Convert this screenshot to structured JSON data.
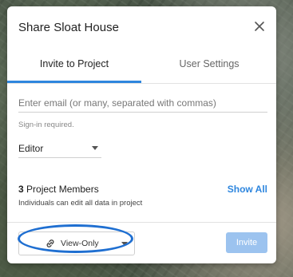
{
  "dialog": {
    "title": "Share Sloat House"
  },
  "tabs": [
    {
      "label": "Invite to Project",
      "active": true
    },
    {
      "label": "User Settings",
      "active": false
    }
  ],
  "invite_form": {
    "email_placeholder": "Enter email (or many, separated with commas)",
    "email_value": "",
    "hint": "Sign-in required.",
    "role": "Editor"
  },
  "members": {
    "count": "3",
    "label": "Project Members",
    "show_all": "Show All",
    "description": "Individuals can edit all data in project"
  },
  "footer": {
    "permission_label": "View-Only",
    "permission_icon": "link-icon",
    "invite_label": "Invite"
  },
  "colors": {
    "accent": "#2e86de",
    "invite_disabled": "#9cc3ef",
    "highlight_ring": "#1f6fd1"
  }
}
